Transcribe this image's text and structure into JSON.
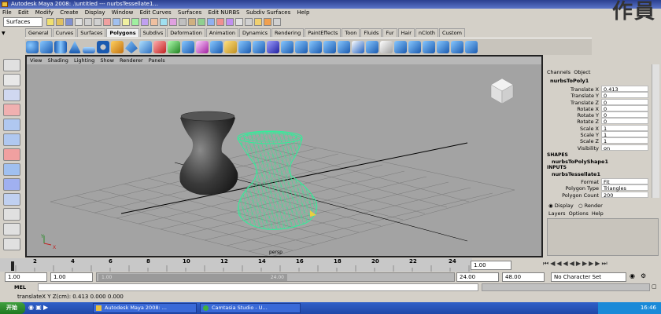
{
  "window": {
    "title": "Autodesk Maya 2008: .\\untitled   ---   nurbsTessellate1...",
    "watermark": "作員"
  },
  "menubar": [
    "File",
    "Edit",
    "Modify",
    "Create",
    "Display",
    "Window",
    "Edit Curves",
    "Surfaces",
    "Edit NURBS",
    "Subdiv Surfaces",
    "Help"
  ],
  "statusline": {
    "menu_set": "Surfaces"
  },
  "shelf": {
    "tabs": [
      "General",
      "Curves",
      "Surfaces",
      "Polygons",
      "Subdivs",
      "Deformation",
      "Animation",
      "Dynamics",
      "Rendering",
      "PaintEffects",
      "Toon",
      "Fluids",
      "Fur",
      "Hair",
      "nCloth",
      "Custom"
    ],
    "active_tab": "Polygons"
  },
  "viewport": {
    "menu": [
      "View",
      "Shading",
      "Lighting",
      "Show",
      "Renderer",
      "Panels"
    ],
    "camera_label": "persp",
    "axis_labels": [
      "Y",
      "X"
    ]
  },
  "channelbox": {
    "header_tabs": [
      "Channels",
      "Object"
    ],
    "node_name": "nurbsToPoly1",
    "channels": [
      {
        "label": "Translate X",
        "value": "0.413"
      },
      {
        "label": "Translate Y",
        "value": "0"
      },
      {
        "label": "Translate Z",
        "value": "0"
      },
      {
        "label": "Rotate X",
        "value": "0"
      },
      {
        "label": "Rotate Y",
        "value": "0"
      },
      {
        "label": "Rotate Z",
        "value": "0"
      },
      {
        "label": "Scale X",
        "value": "1"
      },
      {
        "label": "Scale Y",
        "value": "1"
      },
      {
        "label": "Scale Z",
        "value": "1"
      },
      {
        "label": "Visibility",
        "value": "on"
      }
    ],
    "shapes_header": "SHAPES",
    "shape_name": "nurbsToPolyShape1",
    "inputs_header": "INPUTS",
    "input_name": "nurbsTessellate1",
    "inputs": [
      {
        "label": "Format",
        "value": "Fit"
      },
      {
        "label": "Polygon Type",
        "value": "Triangles"
      },
      {
        "label": "Polygon Count",
        "value": "200"
      }
    ]
  },
  "layer_editor": {
    "display_label": "Display",
    "render_label": "Render",
    "menu": [
      "Layers",
      "Options",
      "Help"
    ]
  },
  "timeline": {
    "ticks": [
      "2",
      "4",
      "6",
      "8",
      "10",
      "12",
      "14",
      "16",
      "18",
      "20",
      "22",
      "24"
    ],
    "current_frame": "1.00"
  },
  "range": {
    "start": "1.00",
    "playback_start": "1.00",
    "slider_start": "1.00",
    "slider_end": "24.00",
    "playback_end": "24.00",
    "end": "48.00",
    "character_set": "No Character Set"
  },
  "command_line": {
    "label": "MEL"
  },
  "help_line": {
    "text": "translateX Y Z(cm):  0.413        0.000        0.000"
  },
  "taskbar": {
    "start": "开始",
    "tasks": [
      "Autodesk Maya 2008: ...",
      "Camtasia Studio - U..."
    ],
    "clock": "16:46"
  },
  "colors": {
    "wireframe": "#29f29a",
    "viewport_bg": "#a3a3a3",
    "selected_tab": "#f0f0f0"
  }
}
